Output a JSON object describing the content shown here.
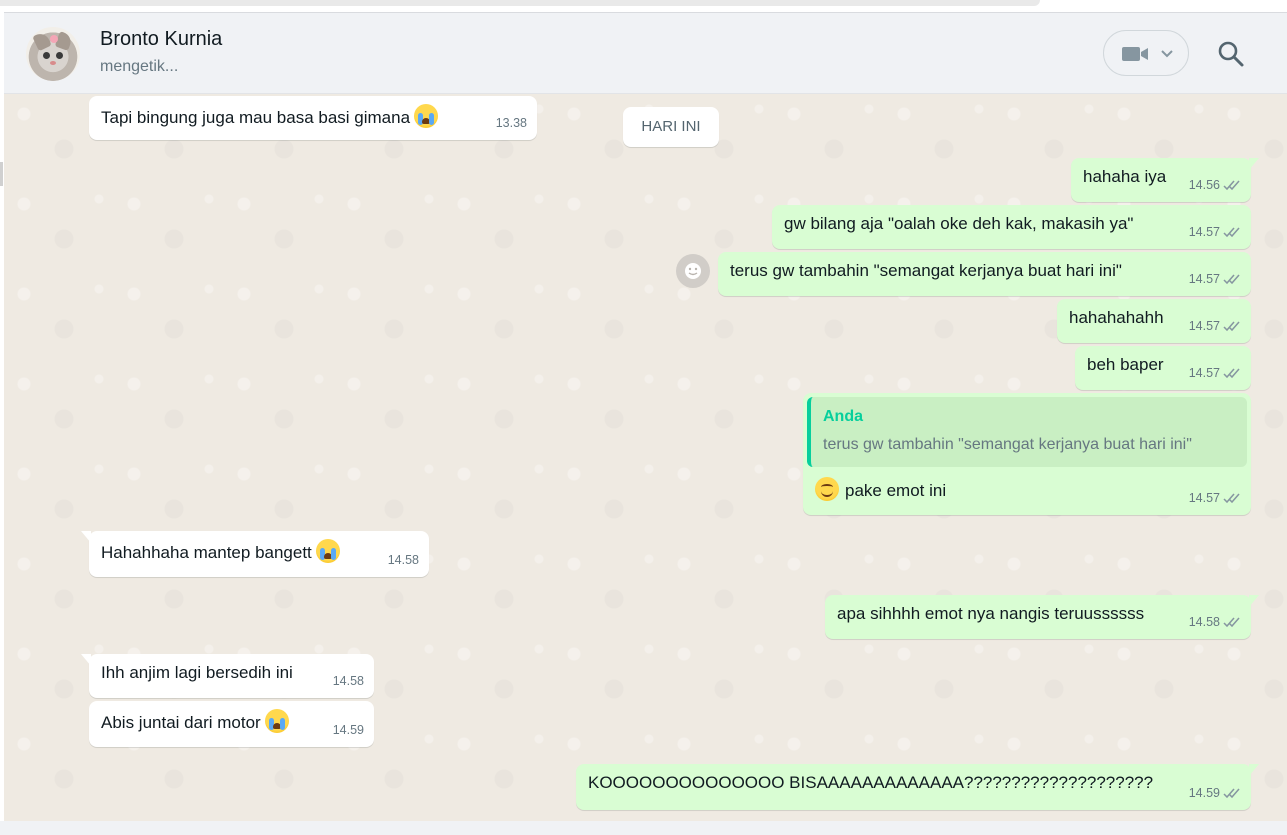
{
  "contact": {
    "name": "Bronto Kurnia",
    "status": "mengetik..."
  },
  "header_icons": [
    "video-call-icon",
    "chevron-down-icon",
    "search-icon"
  ],
  "date_separator": "HARI INI",
  "messages": [
    {
      "dir": "in",
      "text": "Tapi bingung juga mau basa basi gimana",
      "emoji": "crying-face",
      "time": "13.38"
    },
    {
      "dir": "out",
      "text": "hahaha iya",
      "time": "14.56",
      "status": "read"
    },
    {
      "dir": "out",
      "text": "gw bilang aja \"oalah oke deh kak, makasih ya\"",
      "time": "14.57",
      "status": "read"
    },
    {
      "dir": "out",
      "text": "terus gw tambahin \"semangat kerjanya buat hari ini\"",
      "time": "14.57",
      "status": "read"
    },
    {
      "dir": "out",
      "text": "hahahahahh",
      "time": "14.57",
      "status": "read"
    },
    {
      "dir": "out",
      "text": "beh baper",
      "time": "14.57",
      "status": "read"
    },
    {
      "dir": "out",
      "quote_author": "Anda",
      "quote_text": "terus gw tambahin \"semangat kerjanya buat hari ini\"",
      "text": "pake emot ini",
      "emoji": "smiling-face",
      "time": "14.57",
      "status": "read"
    },
    {
      "dir": "in",
      "text": "Hahahhaha mantep bangett",
      "emoji": "crying-face",
      "time": "14.58"
    },
    {
      "dir": "out",
      "text": "apa sihhhh emot nya nangis teruussssss",
      "time": "14.58",
      "status": "read"
    },
    {
      "dir": "in",
      "text": "Ihh anjim lagi bersedih ini",
      "time": "14.58"
    },
    {
      "dir": "in",
      "text": "Abis juntai dari motor",
      "emoji": "crying-face",
      "time": "14.59"
    },
    {
      "dir": "out",
      "text": "KOOOOOOOOOOOOOO BISAAAAAAAAAAAAA????????????????????",
      "time": "14.59",
      "status": "read"
    }
  ],
  "colors": {
    "incoming": "#ffffff",
    "outgoing": "#d9fdd3",
    "chat_background": "#efeae2",
    "quote_accent": "#06cf9c",
    "read_ticks": "#8696a0"
  }
}
